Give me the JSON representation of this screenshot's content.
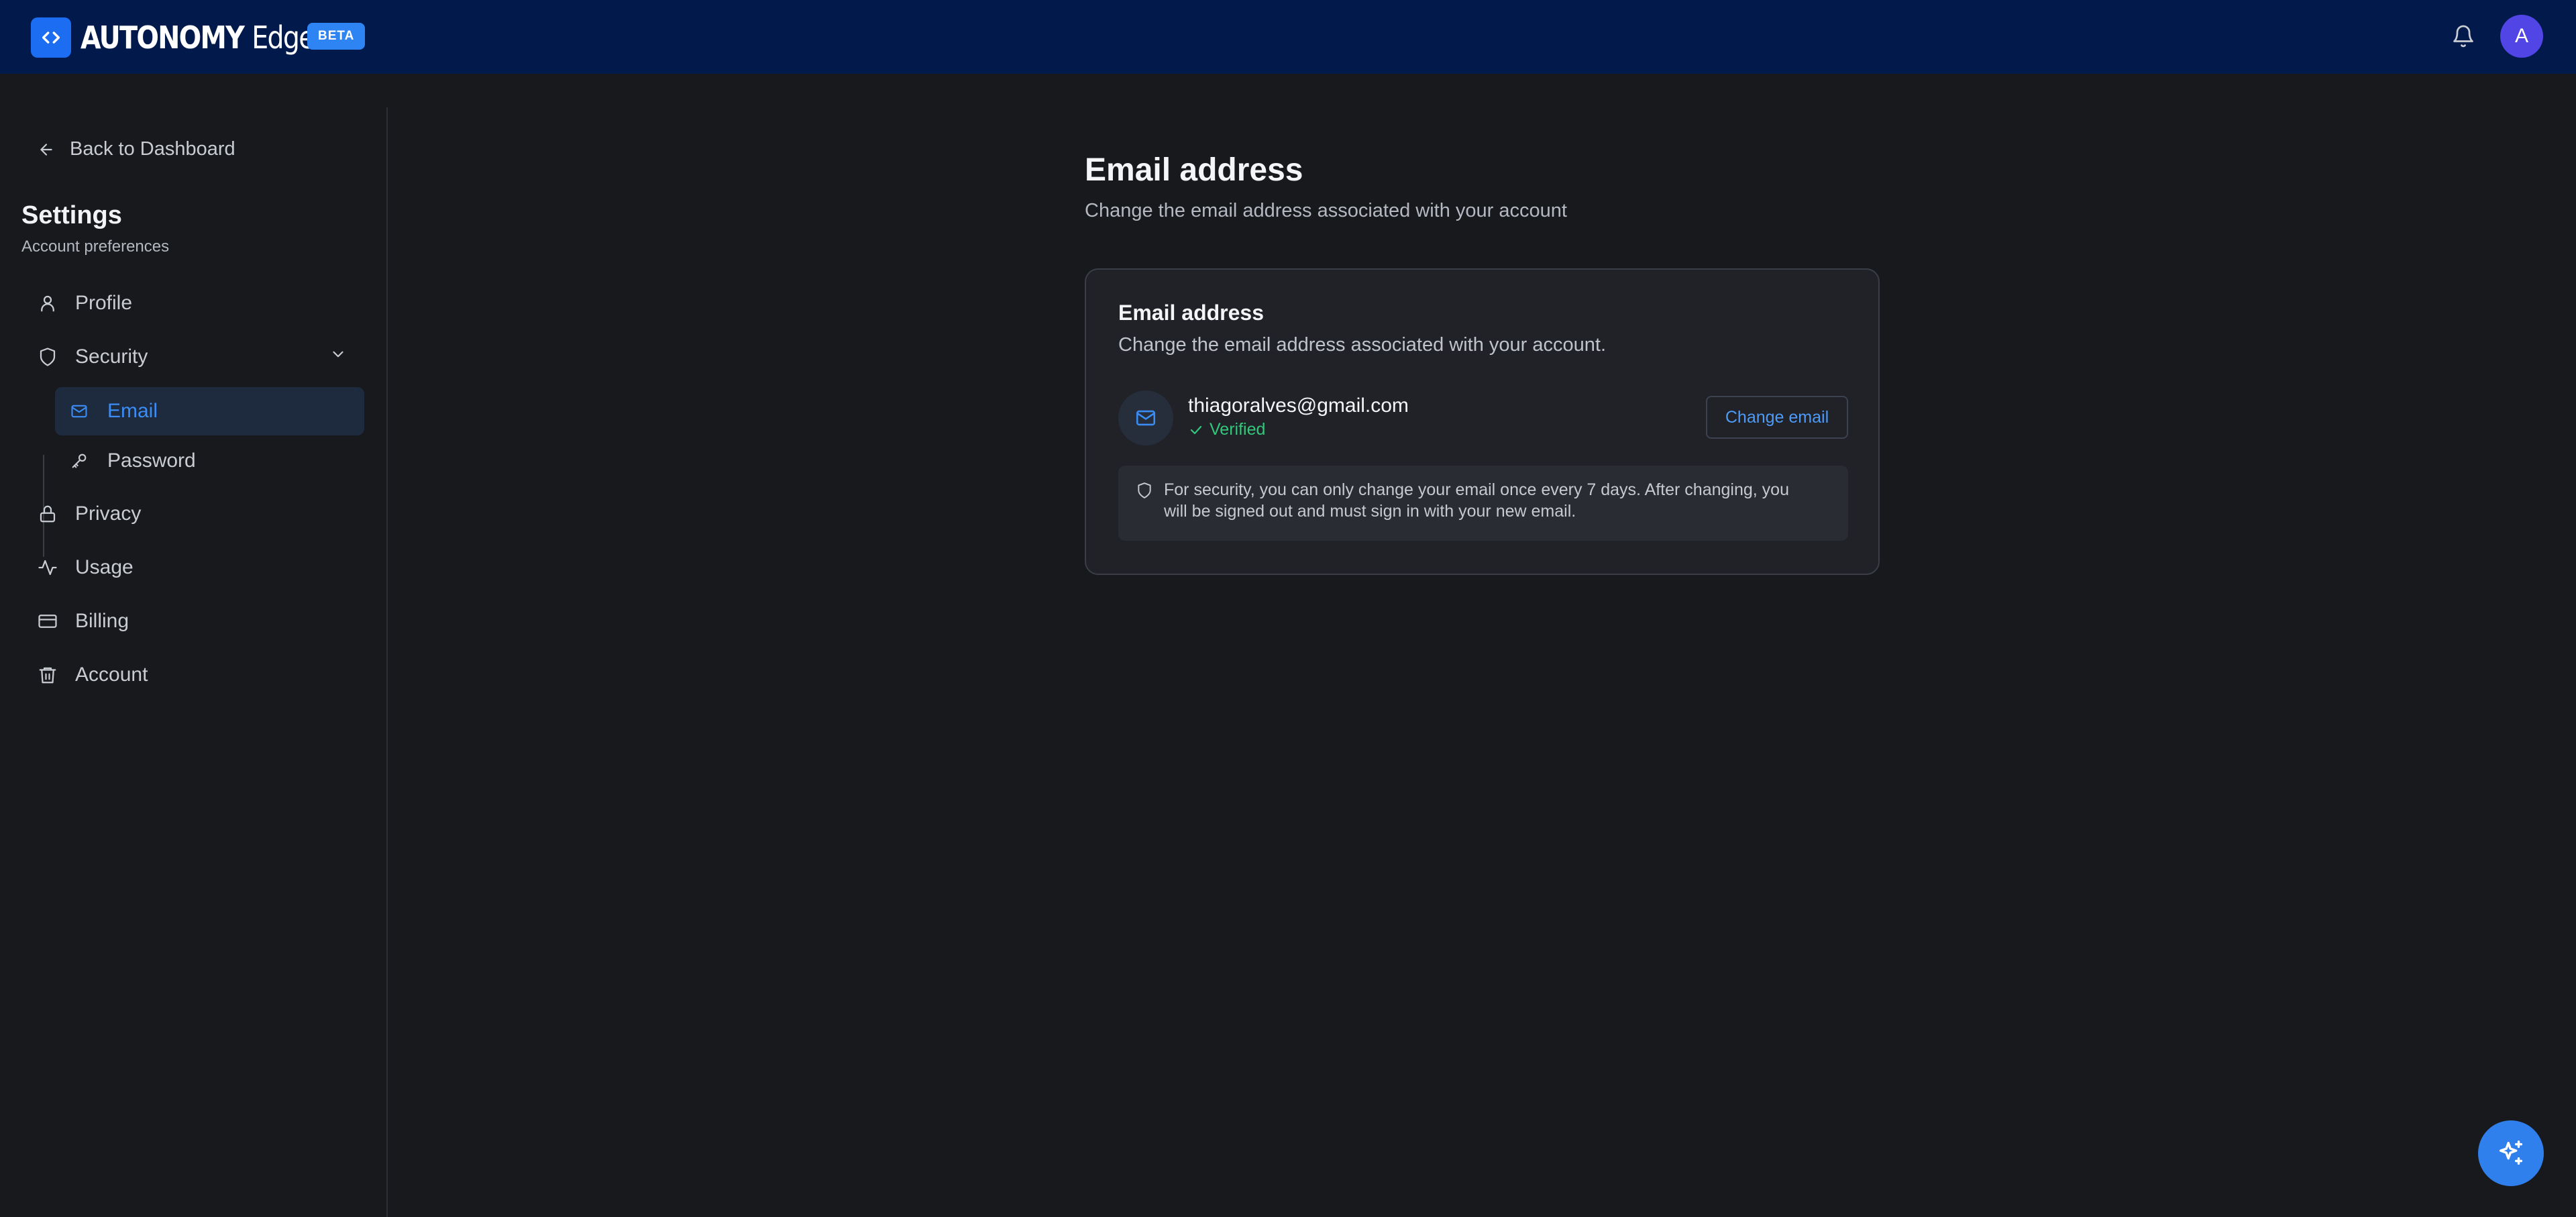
{
  "app": {
    "brand_main": "AUTONOMY",
    "brand_secondary": "Edge",
    "badge": "BETA",
    "avatar_initial": "A"
  },
  "sidebar": {
    "back_label": "Back to Dashboard",
    "title": "Settings",
    "subtitle": "Account preferences",
    "items": [
      {
        "label": "Profile",
        "icon": "user-icon"
      },
      {
        "label": "Security",
        "icon": "shield-icon",
        "expanded": true
      },
      {
        "label": "Privacy",
        "icon": "lock-icon"
      },
      {
        "label": "Usage",
        "icon": "activity-icon"
      },
      {
        "label": "Billing",
        "icon": "credit-card-icon"
      },
      {
        "label": "Account",
        "icon": "trash-icon"
      }
    ],
    "security_subitems": [
      {
        "label": "Email",
        "icon": "mail-icon",
        "active": true
      },
      {
        "label": "Password",
        "icon": "key-icon",
        "active": false
      }
    ]
  },
  "main": {
    "title": "Email address",
    "subtitle": "Change the email address associated with your account",
    "card": {
      "title": "Email address",
      "subtitle": "Change the email address associated with your account.",
      "email": "thiagoralves@gmail.com",
      "status": "Verified",
      "button_label": "Change email",
      "notice_line1": "For security, you can only change your email once every 7 days. After changing, you",
      "notice_line2": "will be signed out and must sign in with your new email."
    }
  },
  "colors": {
    "topbar": "#021a4b",
    "accent": "#2f80ed",
    "background": "#18191d",
    "verified": "#34c77b",
    "active_item_bg": "#1e2a3d"
  }
}
